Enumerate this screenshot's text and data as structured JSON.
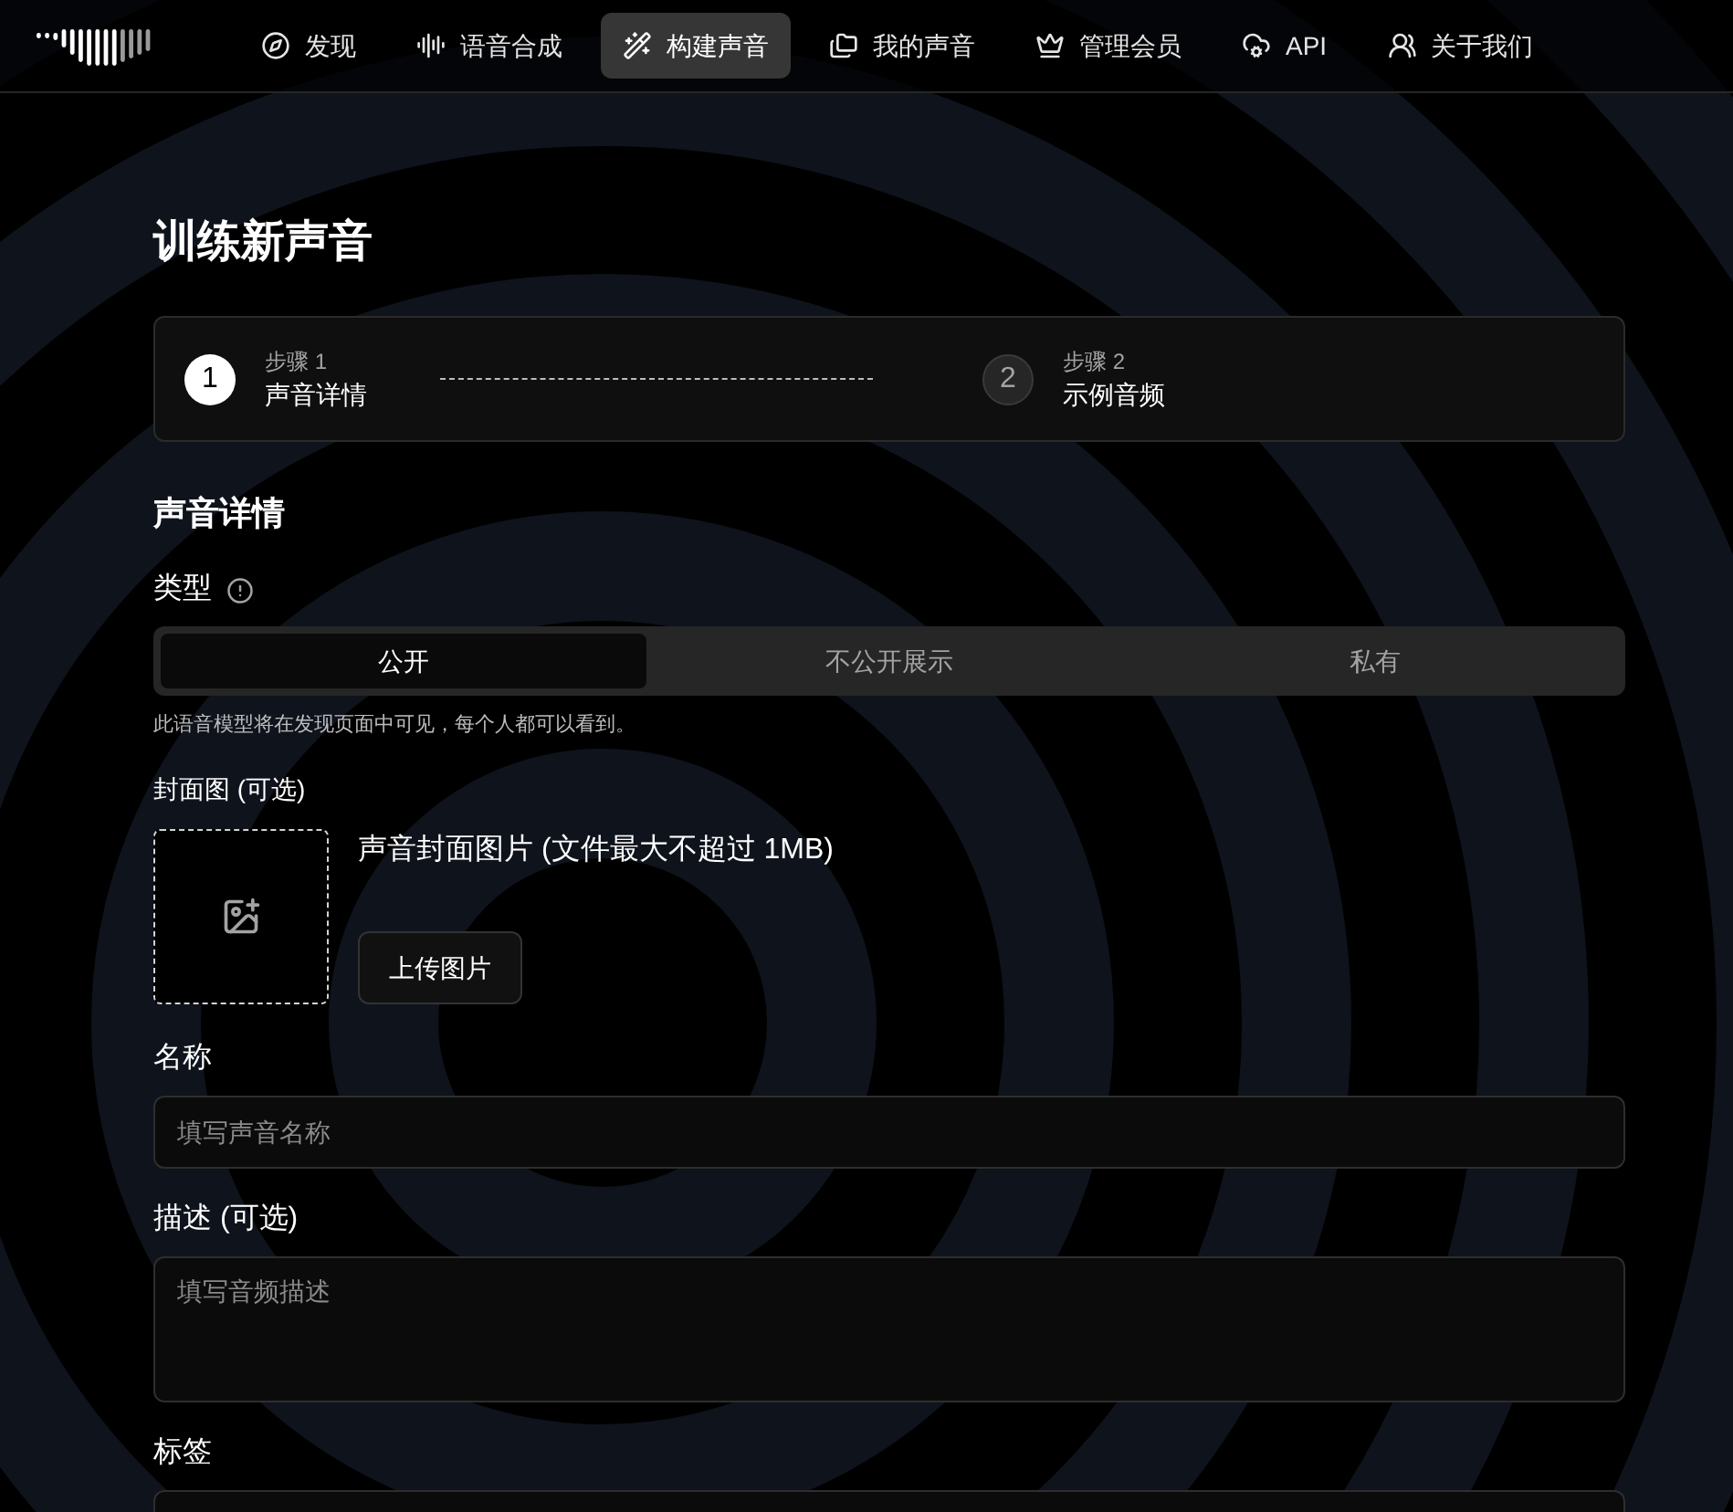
{
  "nav": {
    "items": [
      {
        "label": "发现",
        "selected": false
      },
      {
        "label": "语音合成",
        "selected": false
      },
      {
        "label": "构建声音",
        "selected": true
      },
      {
        "label": "我的声音",
        "selected": false
      },
      {
        "label": "管理会员",
        "selected": false
      },
      {
        "label": "API",
        "selected": false
      },
      {
        "label": "关于我们",
        "selected": false
      }
    ]
  },
  "page": {
    "title": "训练新声音"
  },
  "steps": [
    {
      "number": "1",
      "label": "步骤 1",
      "title": "声音详情",
      "selected": true
    },
    {
      "number": "2",
      "label": "步骤 2",
      "title": "示例音频",
      "selected": false
    }
  ],
  "section": {
    "title": "声音详情"
  },
  "type_field": {
    "label": "类型",
    "options": [
      {
        "label": "公开",
        "selected": true
      },
      {
        "label": "不公开展示",
        "selected": false
      },
      {
        "label": "私有",
        "selected": false
      }
    ],
    "hint": "此语音模型将在发现页面中可见，每个人都可以看到。"
  },
  "cover": {
    "label": "封面图 (可选)",
    "caption": "声音封面图片 (文件最大不超过 1MB)",
    "button": "上传图片"
  },
  "fields": [
    {
      "kind": "input",
      "label": "名称",
      "placeholder": "填写声音名称"
    },
    {
      "kind": "textarea",
      "label": "描述 (可选)",
      "placeholder": "填写音频描述"
    },
    {
      "kind": "input",
      "label": "标签"
    }
  ]
}
